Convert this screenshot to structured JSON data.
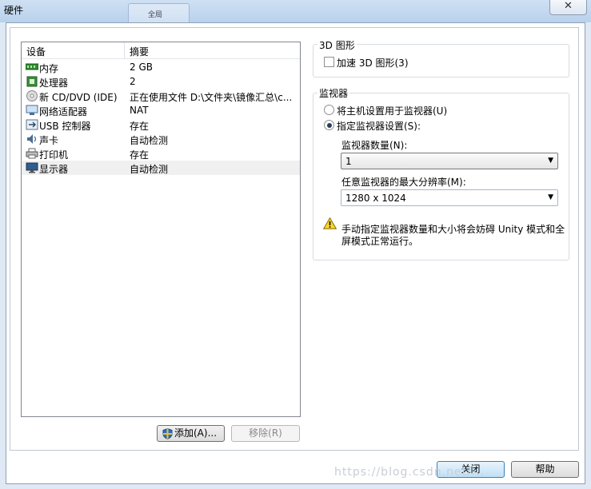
{
  "window": {
    "title": "硬件",
    "ghost_tab_label": "全局",
    "close_glyph": "✕"
  },
  "device_list": {
    "headers": {
      "device": "设备",
      "summary": "摘要"
    },
    "rows": [
      {
        "name": "内存",
        "summary": "2 GB",
        "icon": "memory-icon"
      },
      {
        "name": "处理器",
        "summary": "2",
        "icon": "processor-icon"
      },
      {
        "name": "新 CD/DVD (IDE)",
        "summary": "正在使用文件 D:\\文件夹\\镜像汇总\\c...",
        "icon": "cd-dvd-icon"
      },
      {
        "name": "网络适配器",
        "summary": "NAT",
        "icon": "network-adapter-icon"
      },
      {
        "name": "USB 控制器",
        "summary": "存在",
        "icon": "usb-icon"
      },
      {
        "name": "声卡",
        "summary": "自动检测",
        "icon": "sound-card-icon"
      },
      {
        "name": "打印机",
        "summary": "存在",
        "icon": "printer-icon"
      },
      {
        "name": "显示器",
        "summary": "自动检测",
        "icon": "display-icon",
        "selected": true
      }
    ]
  },
  "list_buttons": {
    "add": "添加(A)...",
    "remove": "移除(R)"
  },
  "graphics_3d": {
    "group_title": "3D 图形",
    "accelerate_label": "加速 3D 图形(3)",
    "accelerate_checked": false
  },
  "monitor": {
    "group_title": "监视器",
    "use_host_label": "将主机设置用于监视器(U)",
    "specify_label": "指定监视器设置(S):",
    "specify_selected": true,
    "count_label": "监视器数量(N):",
    "count_value": "1",
    "max_res_label": "任意监视器的最大分辨率(M):",
    "max_res_value": "1280 x 1024",
    "warning_text": "手动指定监视器数量和大小将会妨碍 Unity 模式和全屏模式正常运行。"
  },
  "dialog_buttons": {
    "close": "关闭",
    "help": "帮助"
  },
  "watermark": "https://blog.csdn.net/..."
}
